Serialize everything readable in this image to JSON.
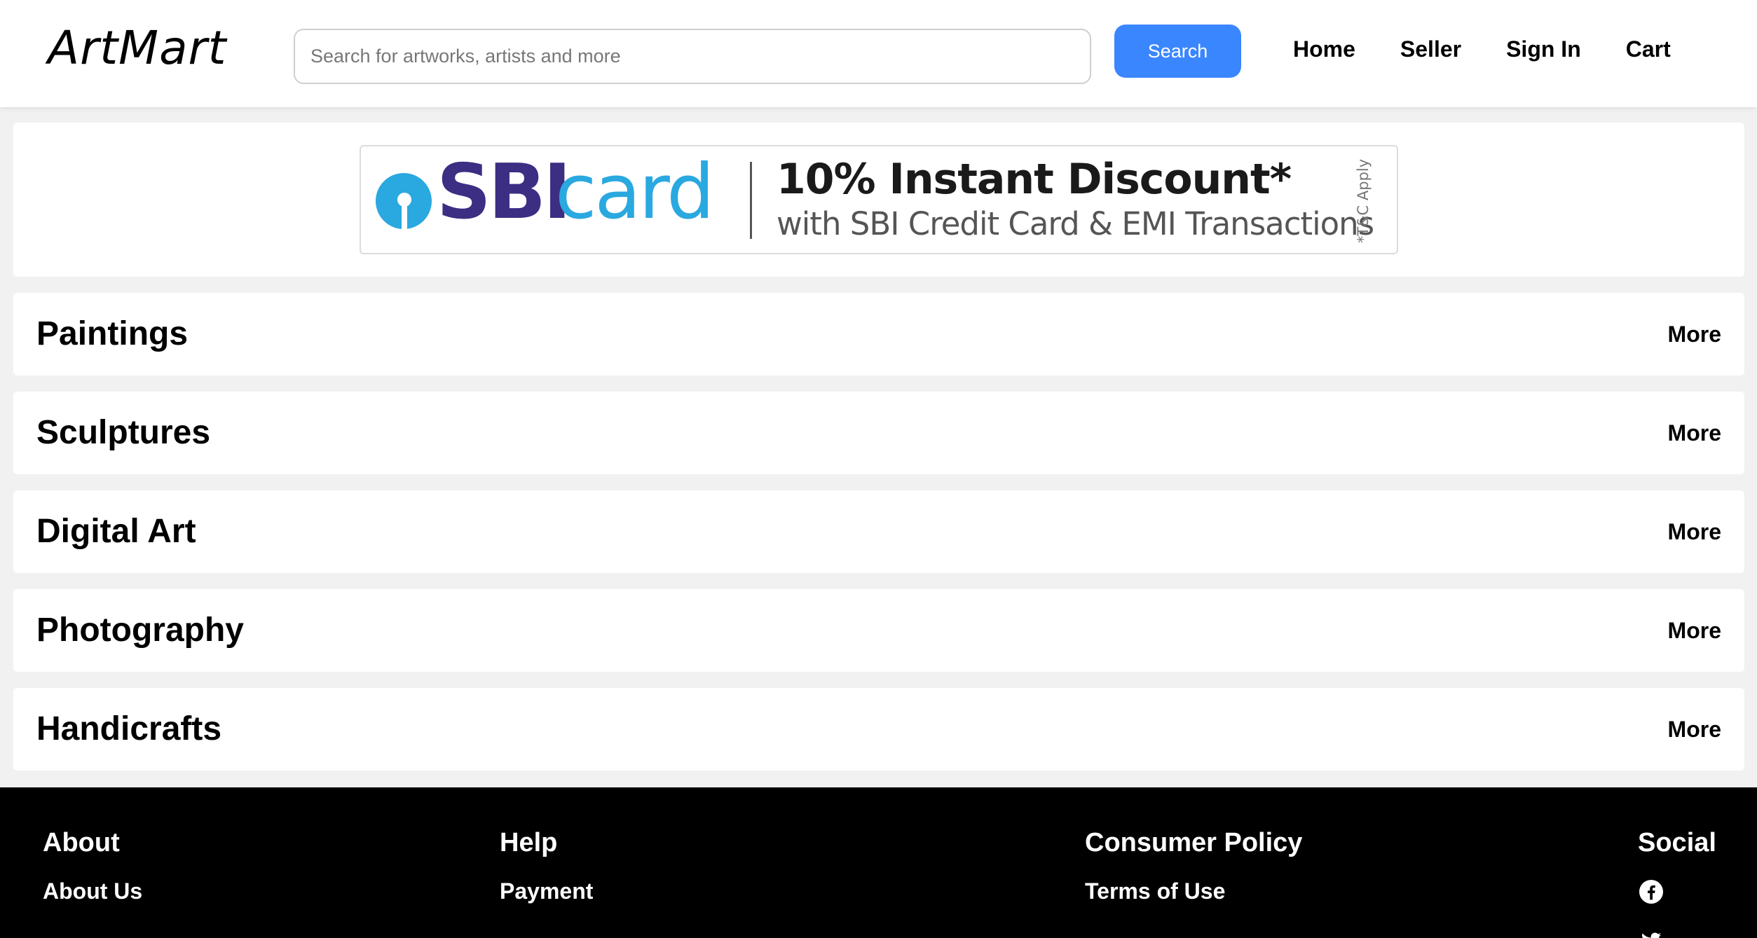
{
  "header": {
    "logo": "ArtMart",
    "search": {
      "placeholder": "Search for artworks, artists and more",
      "value": ""
    },
    "search_button_label": "Search",
    "nav": [
      {
        "label": "Home"
      },
      {
        "label": "Seller"
      },
      {
        "label": "Sign In"
      },
      {
        "label": "Cart"
      }
    ]
  },
  "banner": {
    "brand_primary": "SBI",
    "brand_secondary": "card",
    "headline": "10% Instant Discount*",
    "subline": "with SBI Credit Card & EMI Transactions",
    "terms": "*T&C Apply",
    "colors": {
      "brand_dark": "#3b2e83",
      "brand_light": "#2aa8e0"
    }
  },
  "categories": [
    {
      "title": "Paintings",
      "more_label": "More"
    },
    {
      "title": "Sculptures",
      "more_label": "More"
    },
    {
      "title": "Digital Art",
      "more_label": "More"
    },
    {
      "title": "Photography",
      "more_label": "More"
    },
    {
      "title": "Handicrafts",
      "more_label": "More"
    }
  ],
  "footer": {
    "about": {
      "heading": "About",
      "links": [
        "About Us"
      ]
    },
    "help": {
      "heading": "Help",
      "links": [
        "Payment"
      ]
    },
    "consumer_policy": {
      "heading": "Consumer Policy",
      "links": [
        "Terms of Use"
      ]
    },
    "social": {
      "heading": "Social",
      "icons": [
        "facebook-icon",
        "twitter-icon"
      ]
    }
  },
  "colors": {
    "accent": "#3a86ff",
    "page_background": "#f1f1f1",
    "footer_background": "#000000"
  }
}
